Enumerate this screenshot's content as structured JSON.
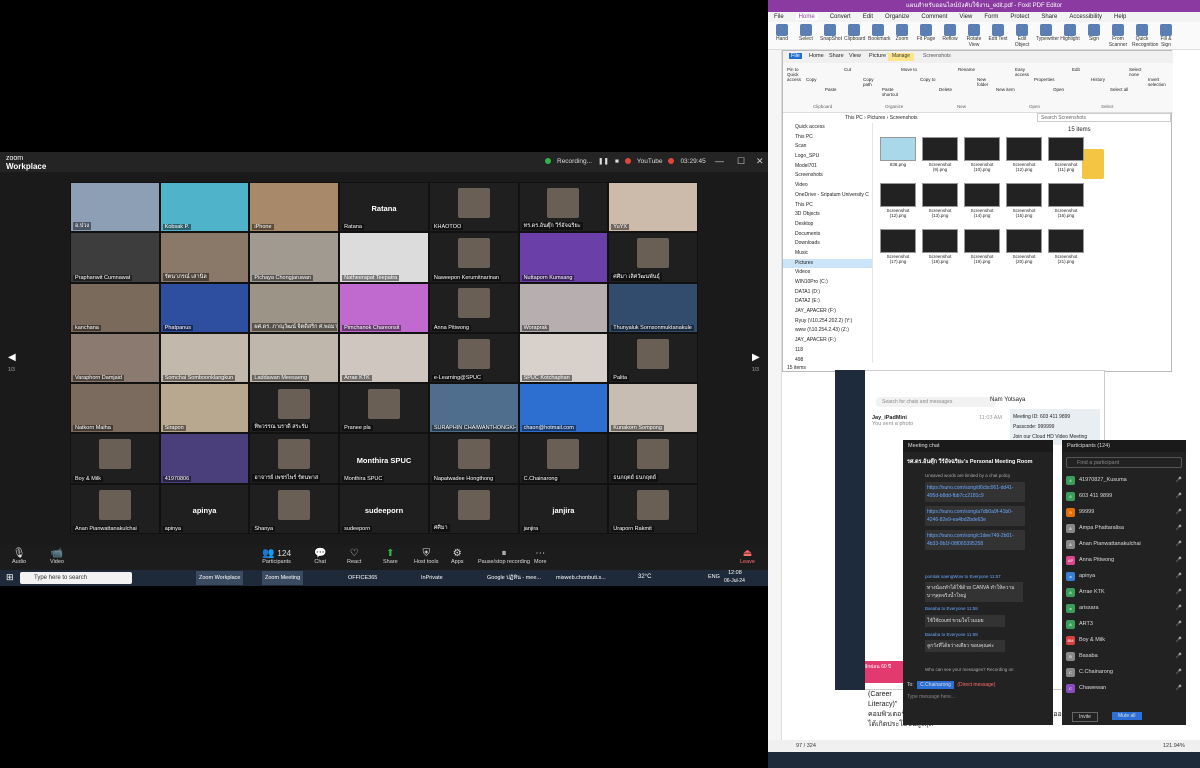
{
  "zoom": {
    "brand": "zoom",
    "app": "Workplace",
    "recording": "Recording...",
    "youtube": "YouTube",
    "timer": "03:29:45",
    "page_left": "1/3",
    "page_right": "1/3",
    "tiles": [
      {
        "name": "อ.ป่วง",
        "bg": "#8d9fb5"
      },
      {
        "name": "Kobsak P.",
        "bg": "#4fb3c9"
      },
      {
        "name": "iPhone",
        "bg": "#a88a6a"
      },
      {
        "name": "Ratana",
        "bg": "#1f1f1f",
        "center": "Ratana"
      },
      {
        "name": "KHAOTOO",
        "bg": "#1f1f1f"
      },
      {
        "name": "ทร.ดร.อ้นตุ๊ก วีร์อัจฉริยะ",
        "bg": "#1f1f1f"
      },
      {
        "name": "YuYX",
        "bg": "#ccbbaa"
      },
      {
        "name": "Praphanwit Cumnawat",
        "bg": "#3d3d3d"
      },
      {
        "name": "รัตนาภรณ์ เสานิล",
        "bg": "#8a7868"
      },
      {
        "name": "Pichaya Chongjaruwan",
        "bg": "#a09a90"
      },
      {
        "name": "Natheerapat Teepatra",
        "bg": "#dcdcdc"
      },
      {
        "name": "Naweepon Kerumitnarinan",
        "bg": "#1f1f1f"
      },
      {
        "name": "Nuttaporn Kumsang",
        "bg": "#6b3fa8"
      },
      {
        "name": "ศศิมา เลิศวัฒนพันธุ์",
        "bg": "#1f1f1f"
      },
      {
        "name": "kanchana",
        "bg": "#7a6a5c"
      },
      {
        "name": "Phatpanus",
        "bg": "#2e4ea0"
      },
      {
        "name": "ผศ.ดร. ภาณุวัฒน์ จิตดิสริก ศ.พอมาดา",
        "bg": "#9d9488"
      },
      {
        "name": "Pimchanok Chareonsit",
        "bg": "#c06ad0"
      },
      {
        "name": "Anna Pitiwong",
        "bg": "#1f1f1f"
      },
      {
        "name": "Woraprak",
        "bg": "#b7aeb0"
      },
      {
        "name": "Thunyaluk Sornsonmuktanakule",
        "bg": "#324c6e"
      },
      {
        "name": "Varaphorn Damjaid",
        "bg": "#8a7a70"
      },
      {
        "name": "Somchai Somboonklangkun",
        "bg": "#c3b8ac"
      },
      {
        "name": "Laddawan Meesaeng",
        "bg": "#bfb6ac"
      },
      {
        "name": "Arrae KTK",
        "bg": "#cfc7bf"
      },
      {
        "name": "e-Learning@SPUC",
        "bg": "#1f1f1f"
      },
      {
        "name": "SPUC Kotchaphan",
        "bg": "#d7d0cb"
      },
      {
        "name": "Palita",
        "bg": "#1f1f1f"
      },
      {
        "name": "Natkorn Malha",
        "bg": "#7b6b5f"
      },
      {
        "name": "Sirapon",
        "bg": "#b8a88f"
      },
      {
        "name": "ทิพวรรณ นราดี สระรัม",
        "bg": "#1f1f1f"
      },
      {
        "name": "Pranee pla",
        "bg": "#1f1f1f"
      },
      {
        "name": "SURAPHIN CHAIWANTHONGKHAM",
        "bg": "#4f6e8e"
      },
      {
        "name": "chaon@hotmail.com",
        "bg": "#2c6fd0"
      },
      {
        "name": "Kunakorn Sompong",
        "bg": "#c8bdb2"
      },
      {
        "name": "Boy & Milk",
        "bg": "#1f1f1f"
      },
      {
        "name": "41970806",
        "bg": "#4a3f7a"
      },
      {
        "name": "อาจารย์ เพชรไพร์ รัตนพาส",
        "bg": "#1f1f1f"
      },
      {
        "name": "Monthira SPUC",
        "bg": "#1f1f1f",
        "center": "Monthira SPUC"
      },
      {
        "name": "Napatwadee Hongthong",
        "bg": "#1f1f1f"
      },
      {
        "name": "C.Chainarong",
        "bg": "#1f1f1f"
      },
      {
        "name": "ธนกฤตย์ ธนกฤตย์",
        "bg": "#1f1f1f"
      },
      {
        "name": "Anan Pianwattanakulchai",
        "bg": "#1f1f1f"
      },
      {
        "name": "apinya",
        "bg": "#1f1f1f",
        "center": "apinya"
      },
      {
        "name": "Shanya",
        "bg": "#1f1f1f"
      },
      {
        "name": "sudeeporn",
        "bg": "#1f1f1f",
        "center": "sudeeporn"
      },
      {
        "name": "ศศิมา",
        "bg": "#1f1f1f"
      },
      {
        "name": "janjira",
        "bg": "#1f1f1f",
        "center": "janjira"
      },
      {
        "name": "Uraporn Rakmit",
        "bg": "#1f1f1f"
      }
    ],
    "toolbar": {
      "audio": "Audio",
      "video": "Video",
      "participants": "Participants",
      "count": "124",
      "chat": "Chat",
      "react": "React",
      "share": "Share",
      "host": "Host tools",
      "apps": "Apps",
      "pause": "Pause/stop recording",
      "more": "More",
      "leave": "Leave"
    }
  },
  "taskbar_left": {
    "search": "Type here to search",
    "items": [
      "Zoom Workplace",
      "Zoom Meeting",
      "OFFICE365",
      "InPrivate",
      "Google ปฏิทิน - mee...",
      "misweb.chonbuti.s..."
    ],
    "temp": "32°C",
    "time": "12:08",
    "date": "06-Jul-24",
    "lang": "ENG"
  },
  "pdf": {
    "title": "แผนสำหรับออนไลน์บังคับใช้งาน_edit.pdf - Foxit PDF Editor",
    "menus": [
      "File",
      "Home",
      "Convert",
      "Edit",
      "Organize",
      "Comment",
      "View",
      "Form",
      "Protect",
      "Share",
      "Accessibility",
      "Help"
    ],
    "ribbon": [
      "Hand",
      "Select",
      "SnapShot",
      "Clipboard",
      "Bookmark",
      "Zoom",
      "Fit Page",
      "Reflow",
      "Rotate View",
      "Edit Text",
      "Edit Object",
      "Typewriter",
      "Highlight",
      "Sign",
      "From Scanner",
      "Quick Recognition",
      "Fill & Sign"
    ],
    "page": "97 / 324",
    "zoom": "121.94%"
  },
  "explorer": {
    "tabs": [
      "File",
      "Home",
      "Share",
      "View",
      "Picture Tools"
    ],
    "manage": "Manage",
    "folder": "Screenshots",
    "ribbon": [
      "Pin to Quick access",
      "Copy",
      "Paste",
      "Cut",
      "Copy path",
      "Paste shortcut",
      "Move to",
      "Copy to",
      "Delete",
      "Rename",
      "New folder",
      "New item",
      "Easy access",
      "Properties",
      "Open",
      "Edit",
      "History",
      "Select all",
      "Select none",
      "Invert selection"
    ],
    "groups": [
      "Clipboard",
      "Organize",
      "New",
      "Open",
      "Select"
    ],
    "path": "This PC › Pictures › Screenshots",
    "search": "Search Screenshots",
    "count": "15 items",
    "status": "15 items",
    "nav": [
      "Quick access",
      "This PC",
      "Scan",
      "Logo_SPU",
      "Model701",
      "Screenshots",
      "Video",
      "OneDrive - Sripatum University C",
      "This PC",
      "3D Objects",
      "Desktop",
      "Documents",
      "Downloads",
      "Music",
      "Pictures",
      "Videos",
      "WIN10Pro (C:)",
      "DATA1 (D:)",
      "DATA2 (E:)",
      "JAY_APACER (F:)",
      "Ryuy (\\\\10.254.202.2) (Y:)",
      "www (\\\\10.254.2.43) (Z:)",
      "JAY_APACER (F:)",
      "118",
      "498"
    ],
    "files": [
      "838.png",
      "Screenshot (9).png",
      "Screenshot (10).png",
      "Screenshot (12).png",
      "Screenshot (11).png",
      "Screenshot (12).png",
      "Screenshot (13).png",
      "Screenshot (14).png",
      "Screenshot (15).png",
      "Screenshot (16).png",
      "Screenshot (17).png",
      "Screenshot (18).png",
      "Screenshot (19).png",
      "Screenshot (20).png",
      "Screenshot (21).png"
    ]
  },
  "line": {
    "search": "Search for chats and messages",
    "contact": "Nam Yotsaya",
    "meeting_id": "Meeting ID: 603 411 9899",
    "passcode": "Passcode: 999999",
    "join": "Join our Cloud HD Video Meeting",
    "chats": [
      {
        "name": "Jay_iPadMini",
        "msg": "You sent a photo",
        "time": "11:03 AM"
      }
    ],
    "ad": "พักผ่อน 60 ปี"
  },
  "meeting_chat": {
    "title": "Meeting chat",
    "room": "รศ.ดร.อ้นตุ๊ก วีร์อัจฉริยะ's Personal Meeting Room",
    "notice": "Unsaved words are limited by a chat policy",
    "links": [
      "https://suno.com/song/d6cbc061-dd41-495d-b8dd-fbb7cc2181c9",
      "https://suno.com/song/a7db0a9f-41b0-4246-82e9-ea4bd2bde63e",
      "https://suno.com/song/c1dee749-2b01-4b33-9b1f-08f065395258"
    ],
    "msg1_from": "pornlak saengWow to Everyone 11:57",
    "msg1": "ทางน้องทำได้ใช้ด้วย CANVA ทำให้ความบาๆสุดจริงน้ำใหญ่",
    "msg2_from": "Basaba to Everyone 11:58",
    "msg2": "ใช้ใช้count ขวมใจโวมเผย",
    "msg3_from": "Basaba to Everyone 11:58",
    "msg3": "ลูกวังที่ได้ยว่างเตียว ขอบคุณค่ะ",
    "who": "Who can see your messages? Recording on",
    "to": "To:",
    "to_target": "C.Chainarong",
    "direct": "(Direct message)",
    "placeholder": "Type message here..."
  },
  "participants": {
    "title": "Participants (124)",
    "search": "Find a participant",
    "list": [
      {
        "n": "41970827_Kusuma",
        "c": "#3a9e5a",
        "i": "4"
      },
      {
        "n": "603 411 9899",
        "c": "#3a9e5a",
        "i": "6"
      },
      {
        "n": "99999",
        "c": "#e2700a",
        "i": "9"
      },
      {
        "n": "Ampa Phattaralisa",
        "c": "#888",
        "i": "A"
      },
      {
        "n": "Anan Pianwattanakulchai",
        "c": "#888",
        "i": "A"
      },
      {
        "n": "Anna Pitiwong",
        "c": "#d9468a",
        "i": "AP"
      },
      {
        "n": "apinya",
        "c": "#3a7ed4",
        "i": "a"
      },
      {
        "n": "Arrae KTK",
        "c": "#3a9e5a",
        "i": "A"
      },
      {
        "n": "arissara",
        "c": "#3a9e5a",
        "i": "a"
      },
      {
        "n": "ART3",
        "c": "#3a9e5a",
        "i": "A"
      },
      {
        "n": "Boy & Milk",
        "c": "#d74040",
        "i": "BM"
      },
      {
        "n": "Basaba",
        "c": "#888",
        "i": "B"
      },
      {
        "n": "C.Chainarong",
        "c": "#888",
        "i": "C"
      },
      {
        "n": "Chawewan",
        "c": "#8a4ac0",
        "i": "C"
      }
    ],
    "invite": "Invite",
    "mute_all": "Mute all"
  }
}
